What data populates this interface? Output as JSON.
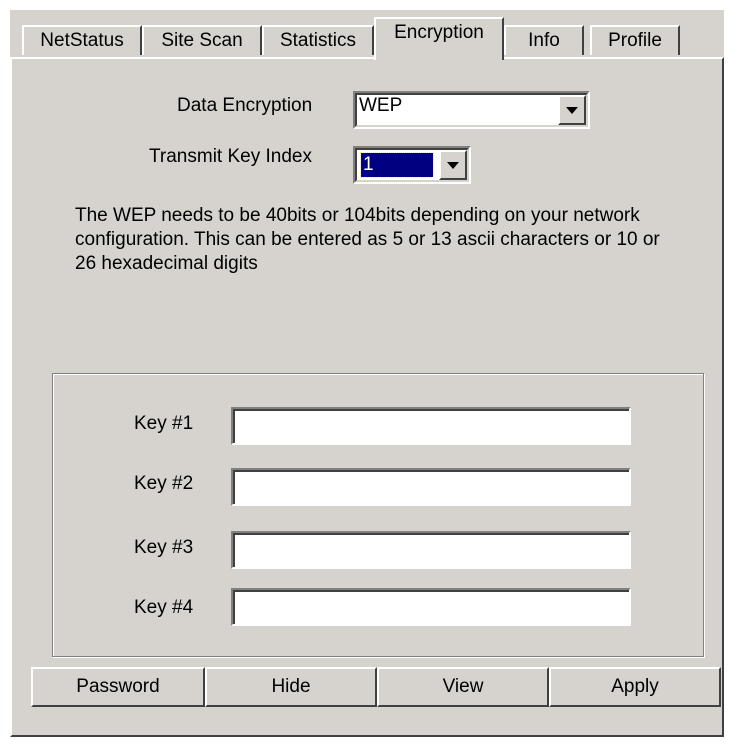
{
  "tabs": [
    {
      "label": "NetStatus"
    },
    {
      "label": "Site Scan"
    },
    {
      "label": "Statistics"
    },
    {
      "label": "Encryption"
    },
    {
      "label": "Info"
    },
    {
      "label": "Profile"
    }
  ],
  "active_tab": "Encryption",
  "encryption": {
    "data_encryption_label": "Data Encryption",
    "data_encryption_value": "WEP",
    "transmit_key_label": "Transmit Key Index",
    "transmit_key_value": "1",
    "description": "The WEP needs to be 40bits or 104bits depending on your network configuration. This can be entered as 5 or 13 ascii characters or 10 or 26 hexadecimal digits"
  },
  "keys": [
    {
      "label": "Key #1",
      "value": ""
    },
    {
      "label": "Key #2",
      "value": ""
    },
    {
      "label": "Key #3",
      "value": ""
    },
    {
      "label": "Key #4",
      "value": ""
    }
  ],
  "buttons": {
    "password": "Password",
    "hide": "Hide",
    "view": "View",
    "apply": "Apply"
  },
  "colors": {
    "face": "#d6d3ce",
    "highlight": "#ffffff",
    "shadow": "#404040",
    "selection": "#000080"
  }
}
